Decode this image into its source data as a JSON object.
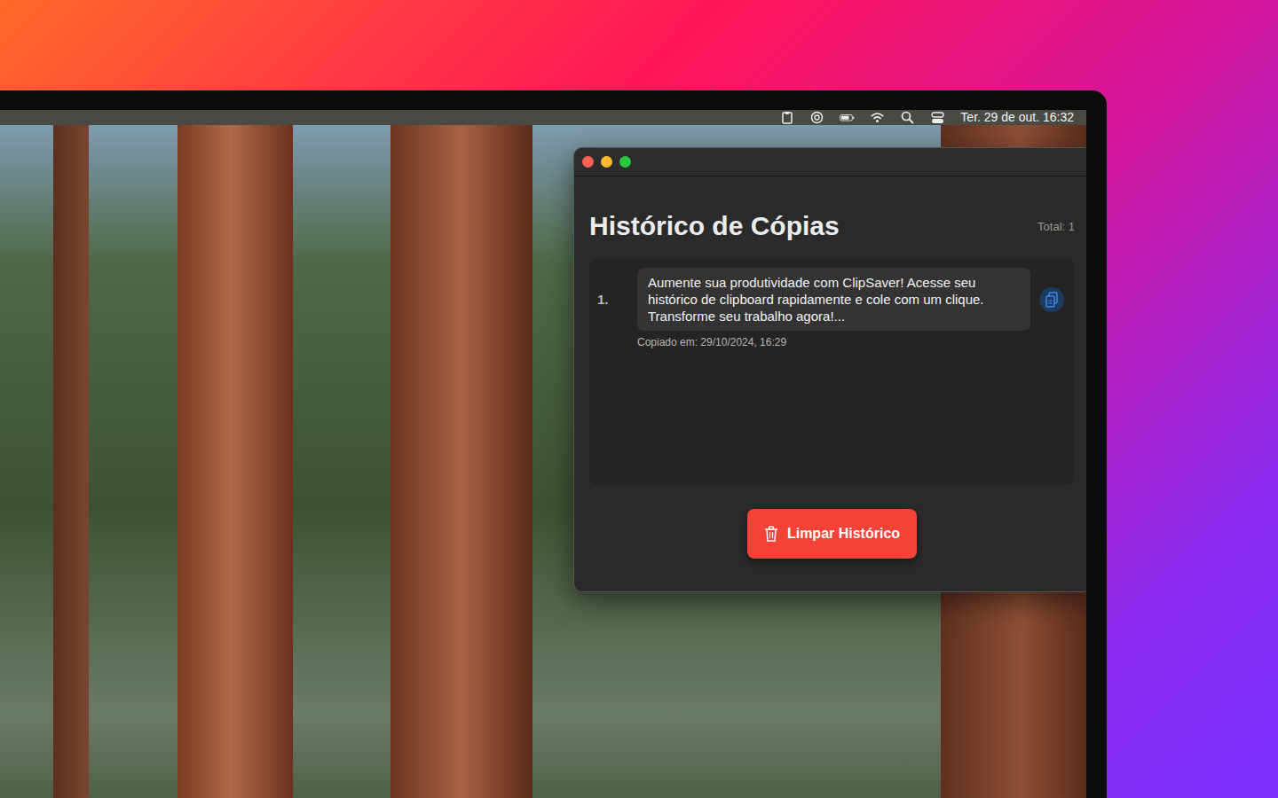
{
  "menu_bar": {
    "clock": "Ter. 29 de out. 16:32"
  },
  "window": {
    "title": "Histórico de Cópias",
    "total": "Total: 1",
    "items": [
      {
        "number": "1.",
        "text": "Aumente sua produtividade com ClipSaver! Acesse seu histórico de clipboard rapidamente e cole com um clique. Transforme seu trabalho agora!...",
        "copied_at": "Copiado em: 29/10/2024, 16:29"
      }
    ],
    "clear_button": {
      "label": "Limpar Histórico"
    }
  }
}
